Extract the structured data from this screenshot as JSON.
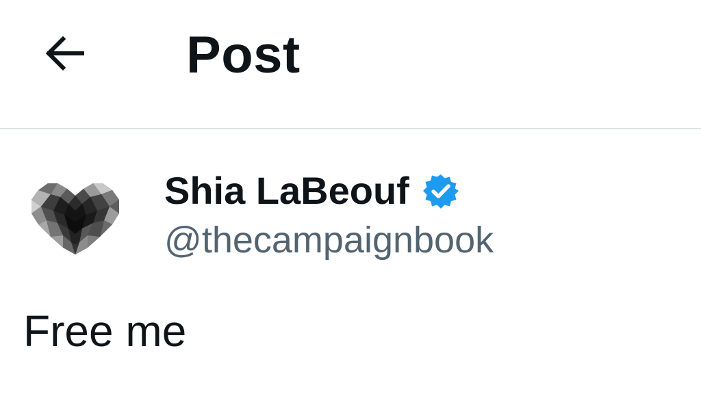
{
  "header": {
    "title": "Post",
    "back_icon": "arrow-left-icon"
  },
  "post": {
    "author": {
      "display_name": "Shia LaBeouf",
      "handle": "@thecampaignbook",
      "verified": true,
      "verified_icon": "verified-badge-icon",
      "avatar": "pixel-heart-avatar"
    },
    "text": "Free me"
  },
  "colors": {
    "text_primary": "#0f1419",
    "text_secondary": "#536471",
    "verified_blue": "#1d9bf0",
    "divider": "#dde1e4",
    "background": "#ffffff"
  }
}
